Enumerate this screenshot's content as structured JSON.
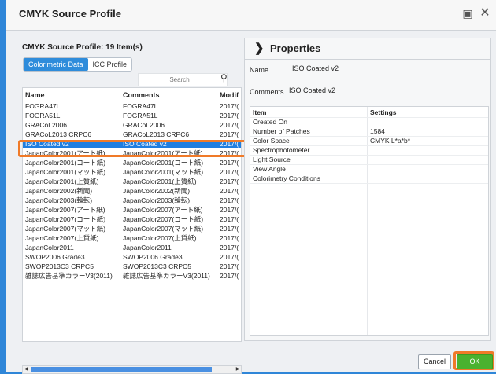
{
  "window": {
    "title": "CMYK Source Profile"
  },
  "left_panel": {
    "header": "CMYK Source Profile: 19 Item(s)",
    "tabs": [
      {
        "label": "Colorimetric Data",
        "active": true
      },
      {
        "label": "ICC Profile",
        "active": false
      }
    ],
    "search_placeholder": "Search",
    "columns": [
      "Name",
      "Comments",
      "Modif"
    ],
    "rows": [
      [
        "FOGRA47L",
        "FOGRA47L",
        "2017/("
      ],
      [
        "FOGRA51L",
        "FOGRA51L",
        "2017/("
      ],
      [
        "GRACoL2006",
        "GRACoL2006",
        "2017/("
      ],
      [
        "GRACoL2013 CRPC6",
        "GRACoL2013 CRPC6",
        "2017/("
      ],
      [
        "ISO Coated v2",
        "ISO Coated v2",
        "2017/("
      ],
      [
        "JapanColor2001(アート紙)",
        "JapanColor2001(アート紙)",
        "2017/("
      ],
      [
        "JapanColor2001(コート紙)",
        "JapanColor2001(コート紙)",
        "2017/("
      ],
      [
        "JapanColor2001(マット紙)",
        "JapanColor2001(マット紙)",
        "2017/("
      ],
      [
        "JapanColor2001(上質紙)",
        "JapanColor2001(上質紙)",
        "2017/("
      ],
      [
        "JapanColor2002(新聞)",
        "JapanColor2002(新聞)",
        "2017/("
      ],
      [
        "JapanColor2003(輪転)",
        "JapanColor2003(輪転)",
        "2017/("
      ],
      [
        "JapanColor2007(アート紙)",
        "JapanColor2007(アート紙)",
        "2017/("
      ],
      [
        "JapanColor2007(コート紙)",
        "JapanColor2007(コート紙)",
        "2017/("
      ],
      [
        "JapanColor2007(マット紙)",
        "JapanColor2007(マット紙)",
        "2017/("
      ],
      [
        "JapanColor2007(上質紙)",
        "JapanColor2007(上質紙)",
        "2017/("
      ],
      [
        "JapanColor2011",
        "JapanColor2011",
        "2017/("
      ],
      [
        "SWOP2006 Grade3",
        "SWOP2006 Grade3",
        "2017/("
      ],
      [
        "SWOP2013C3 CRPC5",
        "SWOP2013C3 CRPC5",
        "2017/("
      ],
      [
        "雑誌広告基準カラーV3(2011)",
        "雑誌広告基準カラーV3(2011)",
        "2017/("
      ]
    ],
    "selected_index": 4
  },
  "properties": {
    "title": "Properties",
    "name_label": "Name",
    "name_value": "ISO Coated v2",
    "comments_label": "Comments",
    "comments_value": "ISO Coated v2",
    "columns": [
      "Item",
      "Settings"
    ],
    "rows": [
      [
        "Created On",
        ""
      ],
      [
        "Number of Patches",
        "1584"
      ],
      [
        "Color Space",
        "CMYK L*a*b*"
      ],
      [
        "Spectrophotometer",
        ""
      ],
      [
        "Light Source",
        ""
      ],
      [
        "View Angle",
        ""
      ],
      [
        "Colorimetry Conditions",
        ""
      ]
    ]
  },
  "buttons": {
    "cancel": "Cancel",
    "ok": "OK"
  },
  "colors": {
    "accent": "#2e8cdb",
    "highlight": "#f07a28",
    "ok": "#4ab22f"
  }
}
